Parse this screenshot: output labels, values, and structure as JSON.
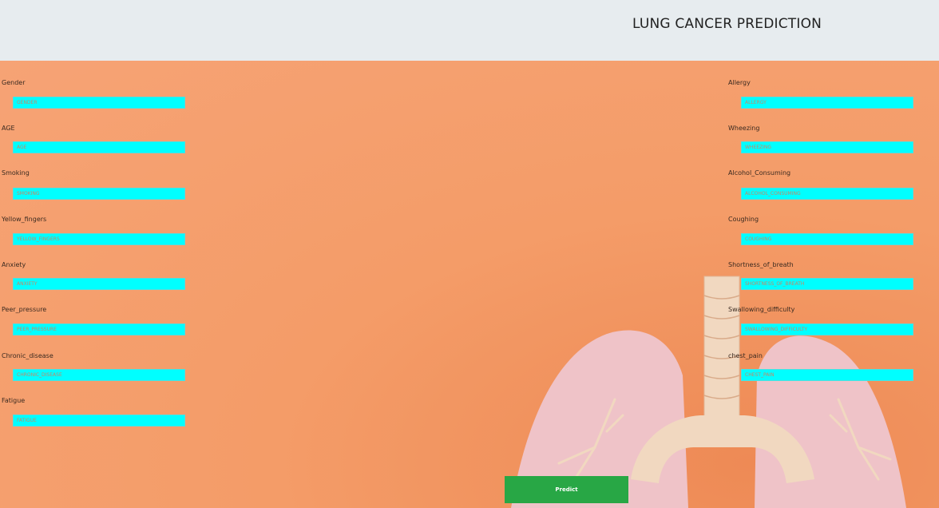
{
  "page": {
    "title": "LUNG CANCER PREDICTION"
  },
  "form": {
    "left_fields": [
      {
        "label": "Gender",
        "placeholder": "GENDER"
      },
      {
        "label": "AGE",
        "placeholder": "AGE"
      },
      {
        "label": "Smoking",
        "placeholder": "SMOKING"
      },
      {
        "label": "Yellow_fingers",
        "placeholder": "YELLOW_FINGERS"
      },
      {
        "label": "Anxiety",
        "placeholder": "ANXIETY"
      },
      {
        "label": "Peer_pressure",
        "placeholder": "PEER_PRESSURE"
      },
      {
        "label": "Chronic_disease",
        "placeholder": "CHRONIC_DISEASE"
      },
      {
        "label": "Fatigue",
        "placeholder": "FATIGUE"
      }
    ],
    "right_fields": [
      {
        "label": "Allergy",
        "placeholder": "ALLERGY"
      },
      {
        "label": "Wheezing",
        "placeholder": "WHEEZING"
      },
      {
        "label": "Alcohol_Consuming",
        "placeholder": "ALCOHOL_CONSUMING"
      },
      {
        "label": "Coughing",
        "placeholder": "COUGHING"
      },
      {
        "label": "Shortness_of_breath",
        "placeholder": "SHORTNESS_OF_BREATH"
      },
      {
        "label": "Swallowing_difficulty",
        "placeholder": "SWALLOWING_DIFFICULTY"
      },
      {
        "label": "chest_pain",
        "placeholder": "CHEST_PAIN"
      }
    ],
    "submit_label": "Predict"
  },
  "colors": {
    "header_bg": "#e7ecef",
    "page_bg": "#f3a070",
    "input_bg": "#00ffff",
    "button_bg": "#28a745"
  }
}
